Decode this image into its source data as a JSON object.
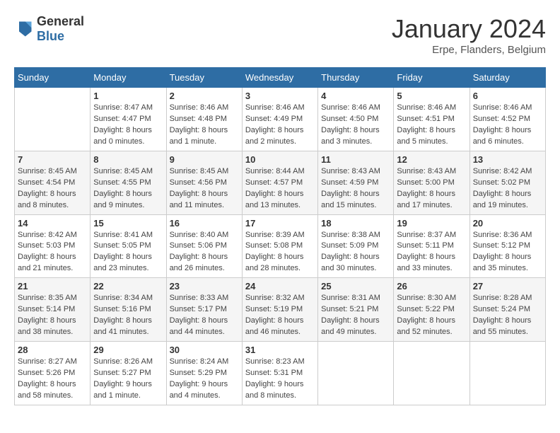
{
  "header": {
    "logo_general": "General",
    "logo_blue": "Blue",
    "month_title": "January 2024",
    "location": "Erpe, Flanders, Belgium"
  },
  "days_of_week": [
    "Sunday",
    "Monday",
    "Tuesday",
    "Wednesday",
    "Thursday",
    "Friday",
    "Saturday"
  ],
  "weeks": [
    [
      {
        "day": "",
        "sunrise": "",
        "sunset": "",
        "daylight": ""
      },
      {
        "day": "1",
        "sunrise": "Sunrise: 8:47 AM",
        "sunset": "Sunset: 4:47 PM",
        "daylight": "Daylight: 8 hours and 0 minutes."
      },
      {
        "day": "2",
        "sunrise": "Sunrise: 8:46 AM",
        "sunset": "Sunset: 4:48 PM",
        "daylight": "Daylight: 8 hours and 1 minute."
      },
      {
        "day": "3",
        "sunrise": "Sunrise: 8:46 AM",
        "sunset": "Sunset: 4:49 PM",
        "daylight": "Daylight: 8 hours and 2 minutes."
      },
      {
        "day": "4",
        "sunrise": "Sunrise: 8:46 AM",
        "sunset": "Sunset: 4:50 PM",
        "daylight": "Daylight: 8 hours and 3 minutes."
      },
      {
        "day": "5",
        "sunrise": "Sunrise: 8:46 AM",
        "sunset": "Sunset: 4:51 PM",
        "daylight": "Daylight: 8 hours and 5 minutes."
      },
      {
        "day": "6",
        "sunrise": "Sunrise: 8:46 AM",
        "sunset": "Sunset: 4:52 PM",
        "daylight": "Daylight: 8 hours and 6 minutes."
      }
    ],
    [
      {
        "day": "7",
        "sunrise": "Sunrise: 8:45 AM",
        "sunset": "Sunset: 4:54 PM",
        "daylight": "Daylight: 8 hours and 8 minutes."
      },
      {
        "day": "8",
        "sunrise": "Sunrise: 8:45 AM",
        "sunset": "Sunset: 4:55 PM",
        "daylight": "Daylight: 8 hours and 9 minutes."
      },
      {
        "day": "9",
        "sunrise": "Sunrise: 8:45 AM",
        "sunset": "Sunset: 4:56 PM",
        "daylight": "Daylight: 8 hours and 11 minutes."
      },
      {
        "day": "10",
        "sunrise": "Sunrise: 8:44 AM",
        "sunset": "Sunset: 4:57 PM",
        "daylight": "Daylight: 8 hours and 13 minutes."
      },
      {
        "day": "11",
        "sunrise": "Sunrise: 8:43 AM",
        "sunset": "Sunset: 4:59 PM",
        "daylight": "Daylight: 8 hours and 15 minutes."
      },
      {
        "day": "12",
        "sunrise": "Sunrise: 8:43 AM",
        "sunset": "Sunset: 5:00 PM",
        "daylight": "Daylight: 8 hours and 17 minutes."
      },
      {
        "day": "13",
        "sunrise": "Sunrise: 8:42 AM",
        "sunset": "Sunset: 5:02 PM",
        "daylight": "Daylight: 8 hours and 19 minutes."
      }
    ],
    [
      {
        "day": "14",
        "sunrise": "Sunrise: 8:42 AM",
        "sunset": "Sunset: 5:03 PM",
        "daylight": "Daylight: 8 hours and 21 minutes."
      },
      {
        "day": "15",
        "sunrise": "Sunrise: 8:41 AM",
        "sunset": "Sunset: 5:05 PM",
        "daylight": "Daylight: 8 hours and 23 minutes."
      },
      {
        "day": "16",
        "sunrise": "Sunrise: 8:40 AM",
        "sunset": "Sunset: 5:06 PM",
        "daylight": "Daylight: 8 hours and 26 minutes."
      },
      {
        "day": "17",
        "sunrise": "Sunrise: 8:39 AM",
        "sunset": "Sunset: 5:08 PM",
        "daylight": "Daylight: 8 hours and 28 minutes."
      },
      {
        "day": "18",
        "sunrise": "Sunrise: 8:38 AM",
        "sunset": "Sunset: 5:09 PM",
        "daylight": "Daylight: 8 hours and 30 minutes."
      },
      {
        "day": "19",
        "sunrise": "Sunrise: 8:37 AM",
        "sunset": "Sunset: 5:11 PM",
        "daylight": "Daylight: 8 hours and 33 minutes."
      },
      {
        "day": "20",
        "sunrise": "Sunrise: 8:36 AM",
        "sunset": "Sunset: 5:12 PM",
        "daylight": "Daylight: 8 hours and 35 minutes."
      }
    ],
    [
      {
        "day": "21",
        "sunrise": "Sunrise: 8:35 AM",
        "sunset": "Sunset: 5:14 PM",
        "daylight": "Daylight: 8 hours and 38 minutes."
      },
      {
        "day": "22",
        "sunrise": "Sunrise: 8:34 AM",
        "sunset": "Sunset: 5:16 PM",
        "daylight": "Daylight: 8 hours and 41 minutes."
      },
      {
        "day": "23",
        "sunrise": "Sunrise: 8:33 AM",
        "sunset": "Sunset: 5:17 PM",
        "daylight": "Daylight: 8 hours and 44 minutes."
      },
      {
        "day": "24",
        "sunrise": "Sunrise: 8:32 AM",
        "sunset": "Sunset: 5:19 PM",
        "daylight": "Daylight: 8 hours and 46 minutes."
      },
      {
        "day": "25",
        "sunrise": "Sunrise: 8:31 AM",
        "sunset": "Sunset: 5:21 PM",
        "daylight": "Daylight: 8 hours and 49 minutes."
      },
      {
        "day": "26",
        "sunrise": "Sunrise: 8:30 AM",
        "sunset": "Sunset: 5:22 PM",
        "daylight": "Daylight: 8 hours and 52 minutes."
      },
      {
        "day": "27",
        "sunrise": "Sunrise: 8:28 AM",
        "sunset": "Sunset: 5:24 PM",
        "daylight": "Daylight: 8 hours and 55 minutes."
      }
    ],
    [
      {
        "day": "28",
        "sunrise": "Sunrise: 8:27 AM",
        "sunset": "Sunset: 5:26 PM",
        "daylight": "Daylight: 8 hours and 58 minutes."
      },
      {
        "day": "29",
        "sunrise": "Sunrise: 8:26 AM",
        "sunset": "Sunset: 5:27 PM",
        "daylight": "Daylight: 9 hours and 1 minute."
      },
      {
        "day": "30",
        "sunrise": "Sunrise: 8:24 AM",
        "sunset": "Sunset: 5:29 PM",
        "daylight": "Daylight: 9 hours and 4 minutes."
      },
      {
        "day": "31",
        "sunrise": "Sunrise: 8:23 AM",
        "sunset": "Sunset: 5:31 PM",
        "daylight": "Daylight: 9 hours and 8 minutes."
      },
      {
        "day": "",
        "sunrise": "",
        "sunset": "",
        "daylight": ""
      },
      {
        "day": "",
        "sunrise": "",
        "sunset": "",
        "daylight": ""
      },
      {
        "day": "",
        "sunrise": "",
        "sunset": "",
        "daylight": ""
      }
    ]
  ]
}
